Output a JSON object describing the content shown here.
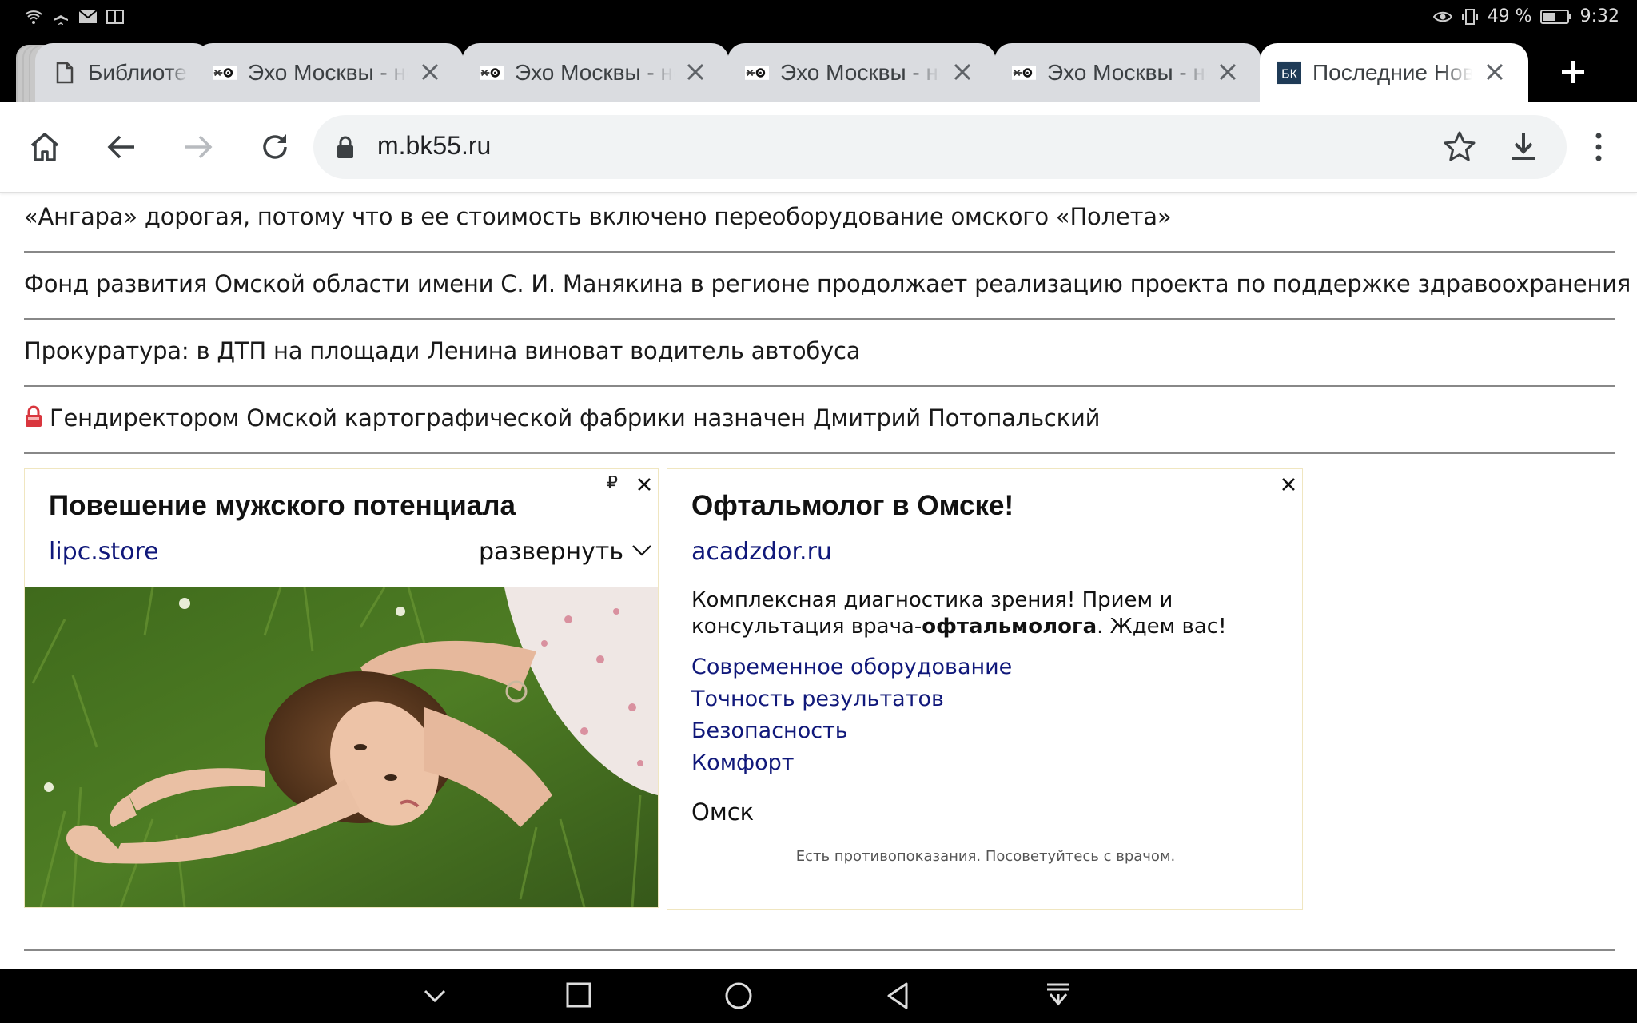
{
  "status_bar": {
    "battery": "49 %",
    "time": "9:32"
  },
  "tabs": [
    {
      "title": "Библиотека",
      "favicon": "page-icon"
    },
    {
      "title": "Эхо Москвы - новости",
      "favicon": "echo-logo-icon"
    },
    {
      "title": "Эхо Москвы - новости",
      "favicon": "echo-logo-icon"
    },
    {
      "title": "Эхо Москвы - новости",
      "favicon": "echo-logo-icon"
    },
    {
      "title": "Эхо Москвы - новости",
      "favicon": "echo-logo-icon"
    },
    {
      "title": "Последние Новости",
      "favicon": "bk-logo-icon",
      "favicon_text": "БК",
      "active": true
    }
  ],
  "toolbar": {
    "url": "m.bk55.ru"
  },
  "news": [
    {
      "text": "«Ангара» дорогая, потому что в ее стоимость включено переоборудование омского «Полета»"
    },
    {
      "text": "Фонд развития Омской области имени С. И. Манякина в регионе продолжает реализацию проекта по поддержке здравоохранения"
    },
    {
      "text": "Прокуратура: в ДТП на площади Ленина виноват водитель автобуса"
    },
    {
      "text": "Гендиректором Омской картографической фабрики назначен Дмитрий Потопальский",
      "locked": true
    }
  ],
  "ad1": {
    "title": "Повешение мужского потенциала",
    "domain": "lipc.store",
    "expand": "развернуть",
    "currency": "₽"
  },
  "ad2": {
    "title": "Офтальмолог в Омске!",
    "domain": "acadzdor.ru",
    "body_part1": "Комплексная диагностика зрения! Прием и консультация врача-",
    "body_bold": "офтальмолога",
    "body_part2": ". Ждем вас!",
    "links": [
      "Современное оборудование",
      "Точность результатов",
      "Безопасность",
      "Комфорт"
    ],
    "city": "Омск",
    "disclaimer": "Есть противопоказания. Посоветуйтесь с врачом."
  },
  "colors": {
    "link": "#10187a",
    "ad_border": "#f0e6c0",
    "divider": "#888888"
  }
}
